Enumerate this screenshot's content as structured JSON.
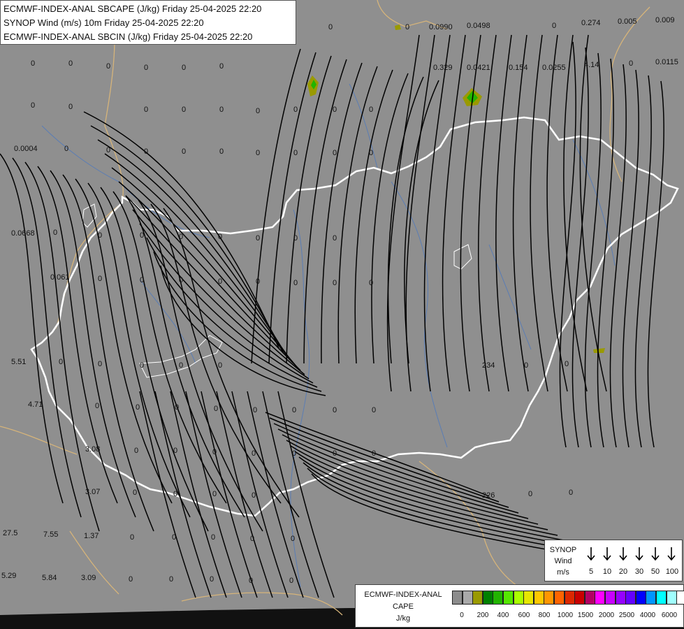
{
  "header": {
    "line1": "ECMWF-INDEX-ANAL SBCAPE (J/kg) Friday 25-04-2025 22:20",
    "line2": "SYNOP Wind (m/s) 10m Friday 25-04-2025 22:20",
    "line3": "ECMWF-INDEX-ANAL SBCIN (J/kg) Friday 25-04-2025 22:20"
  },
  "map_values": [
    "0",
    "0",
    "0.0990",
    "0.0498",
    "0",
    "0.274",
    "0.005",
    "0.009",
    "0",
    "0",
    "0",
    "0",
    "0",
    "0",
    "0.329",
    "0.0421",
    "0.154",
    "0.0255",
    "4.14",
    "0",
    "0.0115",
    "0",
    "0",
    "0",
    "0",
    "0",
    "0",
    "0",
    "0",
    "0",
    "0.0004",
    "0",
    "0",
    "0",
    "0",
    "0",
    "0",
    "0",
    "0",
    "0",
    "0.0668",
    "0",
    "0",
    "0",
    "0",
    "0",
    "0",
    "0",
    "0",
    "0.061",
    "0",
    "0",
    "0",
    "0",
    "0",
    "0",
    "0",
    "0",
    "5.51",
    "0",
    "0",
    "0",
    "0",
    "0",
    "234",
    "0",
    "0",
    "4.71",
    "0",
    "0",
    "0",
    "0",
    "0",
    "0",
    "0",
    "0",
    "3.08",
    "0",
    "0",
    "0",
    "0",
    "0",
    "0",
    "0",
    "3.07",
    "0",
    "0",
    "0",
    "0",
    "226",
    "0",
    "0",
    "27.5",
    "7.55",
    "1.37",
    "0",
    "0",
    "0",
    "0",
    "0",
    "5.29",
    "5.84",
    "3.09",
    "0",
    "0",
    "0",
    "0",
    "0"
  ],
  "wind_legend": {
    "title": "SYNOP",
    "subtitle": "Wind",
    "unit": "m/s",
    "speeds": [
      "5",
      "10",
      "20",
      "30",
      "50",
      "100"
    ]
  },
  "cape_legend": {
    "title": "ECMWF-INDEX-ANAL",
    "subtitle": "CAPE",
    "unit": "J/kg",
    "ticks": [
      "0",
      "200",
      "400",
      "600",
      "800",
      "1000",
      "1500",
      "2000",
      "2500",
      "4000",
      "6000"
    ],
    "colors": [
      "#8c8c8c",
      "#a9a9a9",
      "#9a9a00",
      "#008000",
      "#22b400",
      "#55e600",
      "#aaff00",
      "#e6e600",
      "#ffc800",
      "#ff9600",
      "#ff6400",
      "#dc2800",
      "#c80000",
      "#b40064",
      "#ff00ff",
      "#c800ff",
      "#9600ff",
      "#6400ff",
      "#0000ff",
      "#0096ff",
      "#00ffff",
      "#a0ffff",
      "#ffffff"
    ]
  },
  "colors": {
    "background": "#8f8f8f",
    "border_country": "#ffffff",
    "border_region": "#d6b47a",
    "rivers": "#5a7db5",
    "streamlines": "#000000"
  }
}
